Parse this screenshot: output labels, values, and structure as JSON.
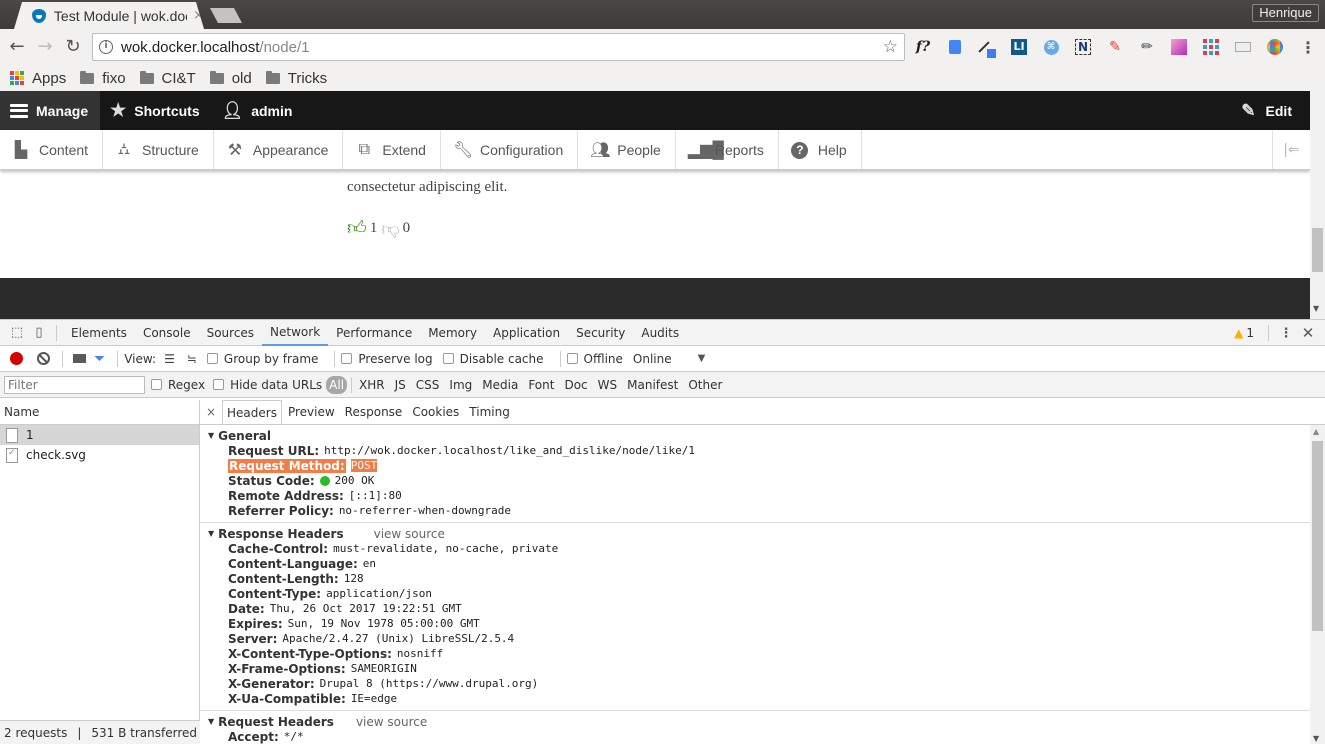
{
  "browser": {
    "tab_title": "Test Module | wok.docker.localhost",
    "tab_close": "×",
    "profile_name": "Henrique",
    "url_host": "wok.docker.localhost",
    "url_path": "/node/1",
    "extensions": [
      "font-finder-icon",
      "google-translate-icon",
      "color-picker-icon",
      "linkedin-icon",
      "shortcut-icon",
      "notes-icon",
      "pen-icon",
      "pencil-icon",
      "gradient-icon",
      "grid-icon",
      "page-ruler-icon",
      "chrome-color-icon"
    ],
    "bookmarks": [
      {
        "label": "Apps",
        "type": "apps"
      },
      {
        "label": "fixo",
        "type": "folder"
      },
      {
        "label": "CI&T",
        "type": "folder"
      },
      {
        "label": "old",
        "type": "folder"
      },
      {
        "label": "Tricks",
        "type": "folder"
      }
    ]
  },
  "drupal": {
    "toolbar": {
      "manage": "Manage",
      "shortcuts": "Shortcuts",
      "user": "admin",
      "edit": "Edit"
    },
    "tray": [
      {
        "label": "Content",
        "icon": "file"
      },
      {
        "label": "Structure",
        "icon": "sitemap"
      },
      {
        "label": "Appearance",
        "icon": "paintbrush"
      },
      {
        "label": "Extend",
        "icon": "puzzle"
      },
      {
        "label": "Configuration",
        "icon": "wrench"
      },
      {
        "label": "People",
        "icon": "people"
      },
      {
        "label": "Reports",
        "icon": "bar-chart"
      },
      {
        "label": "Help",
        "icon": "help"
      }
    ],
    "node_text": "consectetur adipiscing elit.",
    "likes": "1",
    "dislikes": "0"
  },
  "devtools": {
    "tabs": [
      "Elements",
      "Console",
      "Sources",
      "Network",
      "Performance",
      "Memory",
      "Application",
      "Security",
      "Audits"
    ],
    "active_tab": "Network",
    "warnings": "1",
    "toolbar": {
      "view_label": "View:",
      "group_by_frame": "Group by frame",
      "preserve_log": "Preserve log",
      "disable_cache": "Disable cache",
      "offline": "Offline",
      "throttle": "Online"
    },
    "filter": {
      "placeholder": "Filter",
      "regex": "Regex",
      "hide_data_urls": "Hide data URLs",
      "types": [
        "All",
        "XHR",
        "JS",
        "CSS",
        "Img",
        "Media",
        "Font",
        "Doc",
        "WS",
        "Manifest",
        "Other"
      ]
    },
    "requests": {
      "header": "Name",
      "items": [
        {
          "name": "1",
          "selected": true
        },
        {
          "name": "check.svg",
          "selected": false
        }
      ],
      "summary_count": "2 requests",
      "summary_sep": "|",
      "summary_transferred": "531 B transferred"
    },
    "detail_tabs": [
      "Headers",
      "Preview",
      "Response",
      "Cookies",
      "Timing"
    ],
    "detail_close": "×",
    "general": {
      "title": "General",
      "rows": [
        {
          "key": "Request URL:",
          "value": "http://wok.docker.localhost/like_and_dislike/node/like/1"
        },
        {
          "key": "Request Method:",
          "value": "POST"
        },
        {
          "key": "Status Code:",
          "value": "200 OK"
        },
        {
          "key": "Remote Address:",
          "value": "[::1]:80"
        },
        {
          "key": "Referrer Policy:",
          "value": "no-referrer-when-downgrade"
        }
      ]
    },
    "response_headers": {
      "title": "Response Headers",
      "view_source": "view source",
      "rows": [
        {
          "key": "Cache-Control:",
          "value": "must-revalidate, no-cache, private"
        },
        {
          "key": "Content-Language:",
          "value": "en"
        },
        {
          "key": "Content-Length:",
          "value": "128"
        },
        {
          "key": "Content-Type:",
          "value": "application/json"
        },
        {
          "key": "Date:",
          "value": "Thu, 26 Oct 2017 19:22:51 GMT"
        },
        {
          "key": "Expires:",
          "value": "Sun, 19 Nov 1978 05:00:00 GMT"
        },
        {
          "key": "Server:",
          "value": "Apache/2.4.27 (Unix) LibreSSL/2.5.4"
        },
        {
          "key": "X-Content-Type-Options:",
          "value": "nosniff"
        },
        {
          "key": "X-Frame-Options:",
          "value": "SAMEORIGIN"
        },
        {
          "key": "X-Generator:",
          "value": "Drupal 8 (https://www.drupal.org)"
        },
        {
          "key": "X-Ua-Compatible:",
          "value": "IE=edge"
        }
      ]
    },
    "request_headers": {
      "title": "Request Headers",
      "view_source": "view source",
      "rows": [
        {
          "key": "Accept:",
          "value": "*/*"
        }
      ]
    }
  },
  "colors": {
    "highlight": "#f27d46",
    "status_ok": "#27b92e",
    "record": "#d50000",
    "like_green": "#2a8a12"
  }
}
